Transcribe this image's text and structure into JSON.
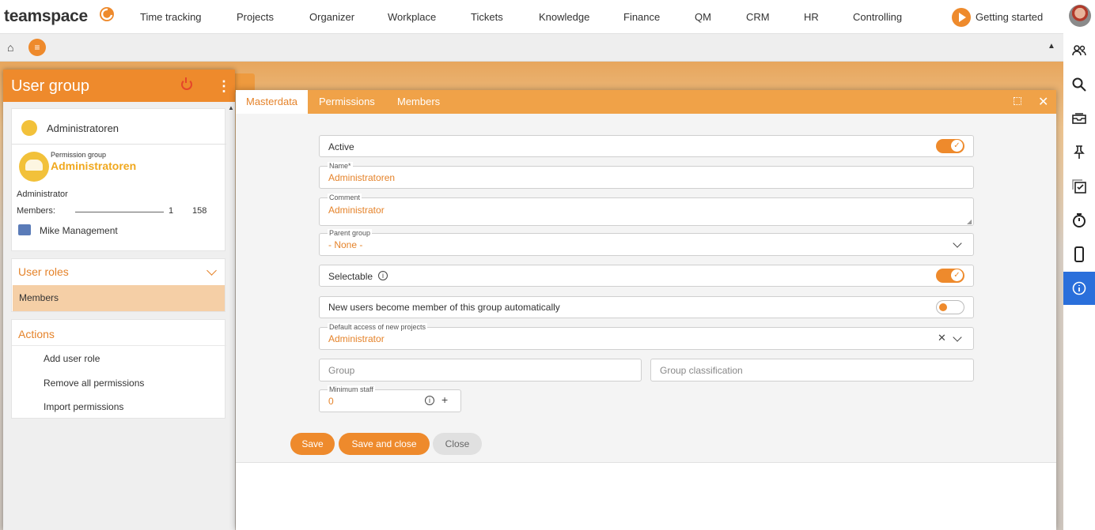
{
  "app": {
    "logo_text": "teamspace"
  },
  "nav": {
    "items": [
      "Time tracking",
      "Projects",
      "Organizer",
      "Workplace",
      "Tickets",
      "Knowledge",
      "Finance",
      "QM",
      "CRM",
      "HR",
      "Controlling"
    ],
    "getting_started": "Getting started"
  },
  "subbar": {
    "home_icon": "home-icon",
    "menu_icon": "menu-icon",
    "collapse_icon": "collapse-up-icon"
  },
  "rightbar": {
    "icons": [
      "people-icon",
      "search-icon",
      "inbox-icon",
      "pin-icon",
      "checklist-icon",
      "stopwatch-icon",
      "mobile-icon",
      "info-icon"
    ],
    "active": "info-icon"
  },
  "left_panel": {
    "title": "User group",
    "group": {
      "name": "Administratoren",
      "type_label": "Permission group",
      "type_name": "Administratoren",
      "comment": "Administrator",
      "members_label": "Members:",
      "count_entities": "1",
      "count_checked": "158",
      "member": "Mike Management"
    },
    "roles": {
      "label": "User roles",
      "selected": "Members"
    },
    "actions": {
      "label": "Actions",
      "items": [
        "Add user role",
        "Remove all permissions",
        "Import permissions"
      ]
    }
  },
  "dialog": {
    "tabs": [
      "Masterdata",
      "Permissions",
      "Members"
    ],
    "active_tab": "Masterdata",
    "fields": {
      "active": {
        "label": "Active",
        "value": true
      },
      "name": {
        "label": "Name*",
        "value": "Administratoren"
      },
      "comment": {
        "label": "Comment",
        "value": "Administrator"
      },
      "parent_group": {
        "label": "Parent group",
        "value": "- None -"
      },
      "selectable": {
        "label": "Selectable",
        "value": true
      },
      "auto_member": {
        "label": "New users become member of this group automatically",
        "value": false
      },
      "default_access": {
        "label": "Default access of new projects",
        "value": "Administrator"
      },
      "group": {
        "placeholder": "Group"
      },
      "group_classification": {
        "placeholder": "Group classification"
      },
      "minimum_staff": {
        "label": "Minimum staff",
        "value": "0"
      }
    },
    "buttons": {
      "save": "Save",
      "save_and_close": "Save and close",
      "close": "Close"
    }
  },
  "colors": {
    "accent": "#ee8a2c",
    "accent_light": "#f0a248",
    "selected_row": "#f5cfa6",
    "active_sidebar": "#2a6fdb"
  }
}
